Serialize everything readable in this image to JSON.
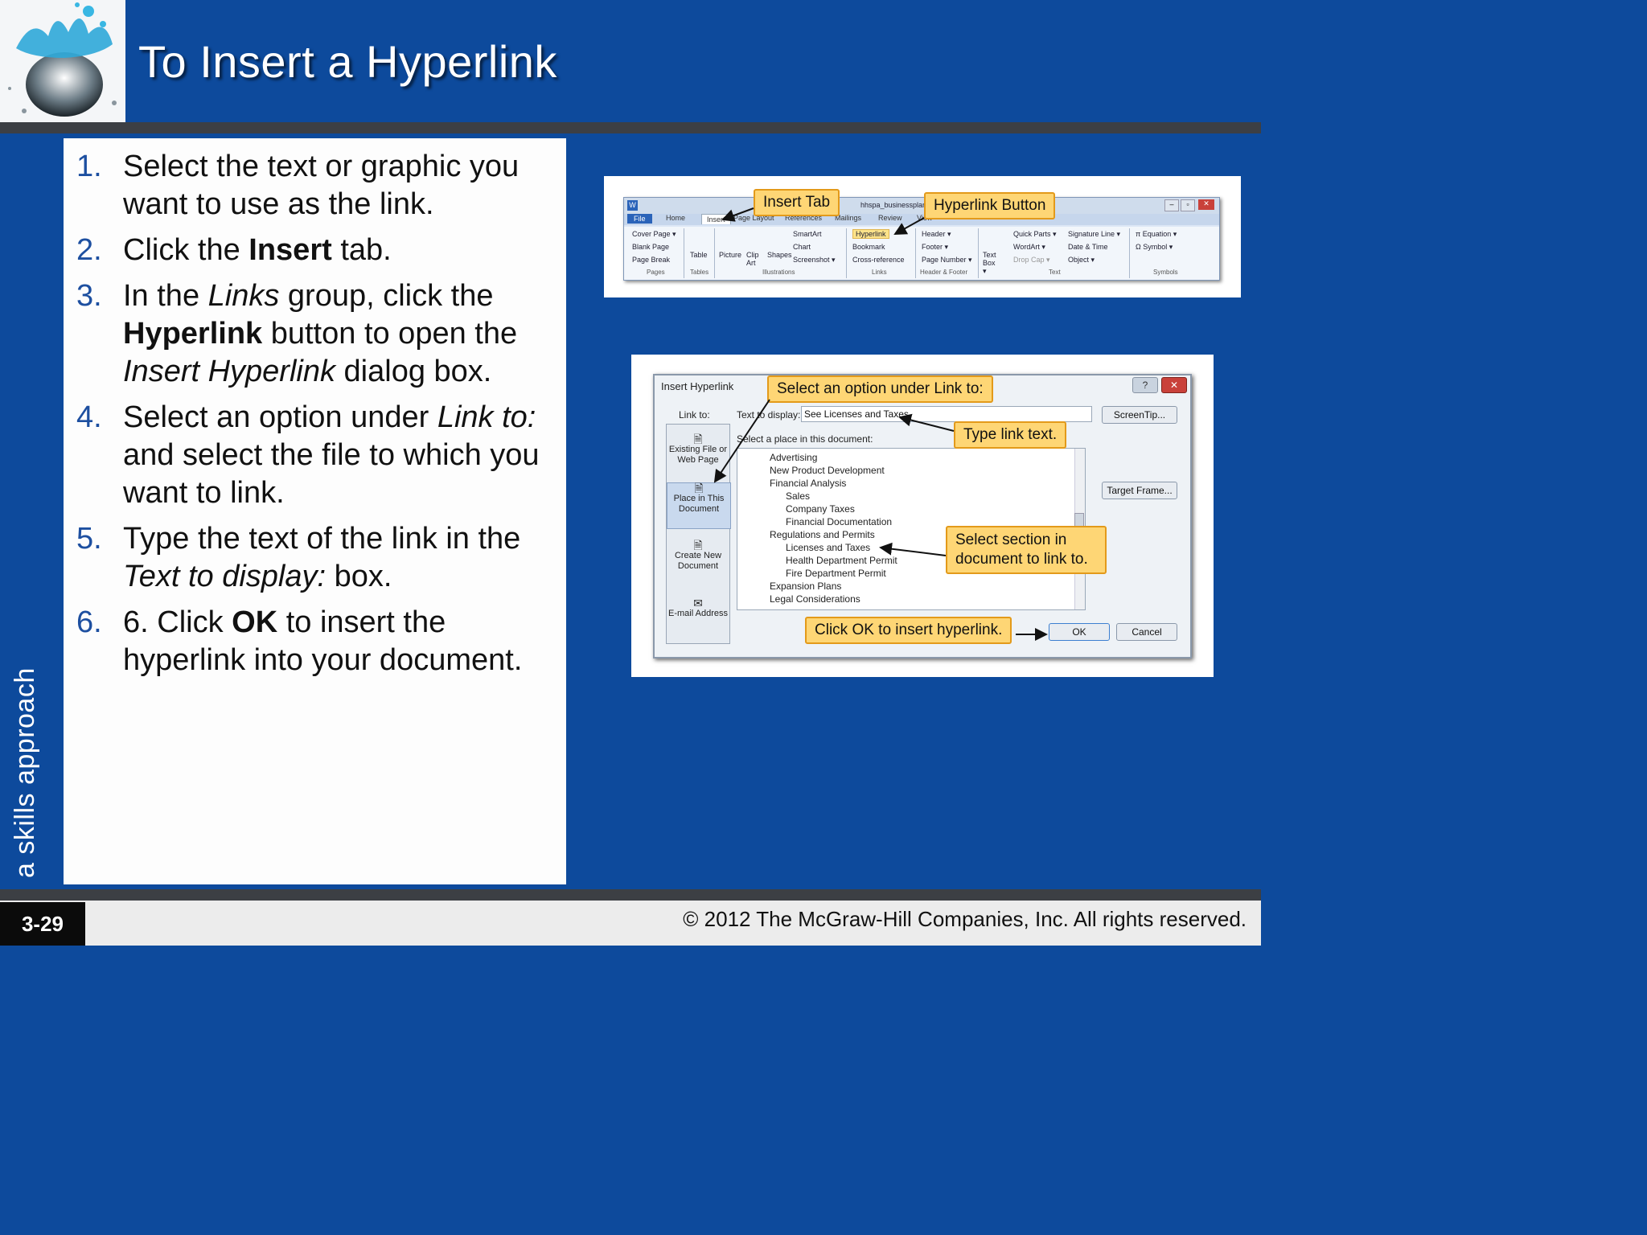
{
  "slide": {
    "title": "To Insert a Hyperlink",
    "side_label": "a skills approach",
    "slide_number": "3-29",
    "copyright": "© 2012 The McGraw-Hill Companies, Inc. All rights reserved."
  },
  "steps": [
    {
      "num": "1.",
      "segments": [
        {
          "t": "Select the text or graphic you want to use as the link.",
          "s": "n"
        }
      ]
    },
    {
      "num": "2.",
      "segments": [
        {
          "t": "Click the ",
          "s": "n"
        },
        {
          "t": "Insert",
          "s": "b"
        },
        {
          "t": " tab.",
          "s": "n"
        }
      ]
    },
    {
      "num": "3.",
      "segments": [
        {
          "t": "In the ",
          "s": "n"
        },
        {
          "t": "Links",
          "s": "i"
        },
        {
          "t": " group, click the ",
          "s": "n"
        },
        {
          "t": "Hyperlink",
          "s": "b"
        },
        {
          "t": " button to open the ",
          "s": "n"
        },
        {
          "t": "Insert Hyperlink",
          "s": "i"
        },
        {
          "t": " dialog box.",
          "s": "n"
        }
      ]
    },
    {
      "num": "4.",
      "segments": [
        {
          "t": "Select an option under ",
          "s": "n"
        },
        {
          "t": "Link to:",
          "s": "i"
        },
        {
          "t": " and select the file to which you want to link.",
          "s": "n"
        }
      ]
    },
    {
      "num": "5.",
      "segments": [
        {
          "t": "Type the text of the link in the ",
          "s": "n"
        },
        {
          "t": "Text to display:",
          "s": "i"
        },
        {
          "t": " box.",
          "s": "n"
        }
      ]
    },
    {
      "num": "6.",
      "segments": [
        {
          "t": "6. Click ",
          "s": "n"
        },
        {
          "t": "OK",
          "s": "b"
        },
        {
          "t": " to insert the hyperlink into your document.",
          "s": "n"
        }
      ]
    }
  ],
  "ribbon": {
    "doc_title": "hhspa_businessplan",
    "tabs": [
      "File",
      "Home",
      "Insert",
      "Page Layout",
      "References",
      "Mailings",
      "Review",
      "View"
    ],
    "items": {
      "cover_page": "Cover Page ▾",
      "blank_page": "Blank Page",
      "page_break": "Page Break",
      "table": "Table",
      "picture": "Picture",
      "clip_art": "Clip Art",
      "shapes": "Shapes",
      "smartart": "SmartArt",
      "chart": "Chart",
      "screenshot": "Screenshot ▾",
      "hyperlink": "Hyperlink",
      "bookmark": "Bookmark",
      "cross_reference": "Cross-reference",
      "header": "Header ▾",
      "footer": "Footer ▾",
      "page_number": "Page Number ▾",
      "text_box": "Text Box ▾",
      "quick_parts": "Quick Parts ▾",
      "wordart": "WordArt ▾",
      "drop_cap": "Drop Cap ▾",
      "signature_line": "Signature Line ▾",
      "date_time": "Date & Time",
      "object": "Object ▾",
      "equation": "π Equation ▾",
      "symbol": "Ω Symbol ▾"
    },
    "groups": [
      "Pages",
      "Tables",
      "Illustrations",
      "Links",
      "Header & Footer",
      "Text",
      "Symbols"
    ],
    "callouts": {
      "insert_tab": "Insert Tab",
      "hyperlink_button": "Hyperlink Button"
    }
  },
  "dialog": {
    "title": "Insert Hyperlink",
    "link_to_label": "Link to:",
    "text_to_display_label": "Text to display:",
    "text_to_display_value": "See Licenses and Taxes",
    "screentip": "ScreenTip...",
    "select_place_label": "Select a place in this document:",
    "target_frame": "Target Frame...",
    "link_options": [
      "Existing File or Web Page",
      "Place in This Document",
      "Create New Document",
      "E-mail Address"
    ],
    "tree": [
      "Advertising",
      "New Product Development",
      "Financial Analysis",
      "Sales",
      "Company Taxes",
      "Financial Documentation",
      "Regulations and Permits",
      "Licenses and Taxes",
      "Health Department Permit",
      "Fire Department Permit",
      "Expansion Plans",
      "Legal Considerations"
    ],
    "ok": "OK",
    "cancel": "Cancel",
    "callouts": {
      "link_to": "Select an option under Link to:",
      "type_text": "Type link text.",
      "select_section": "Select section in document to link to.",
      "click_ok": "Click OK to insert hyperlink."
    }
  }
}
